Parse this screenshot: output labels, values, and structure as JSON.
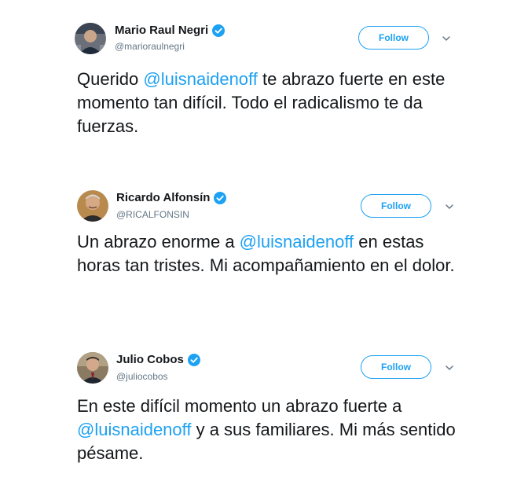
{
  "accent_color": "#1da1f2",
  "verified_badge_color": "#1da1f2",
  "tweets": [
    {
      "display_name": "Mario Raul Negri",
      "handle": "@marioraulnegri",
      "verified": true,
      "follow_label": "Follow",
      "text_before": "Querido ",
      "mention": "@luisnaidenoff",
      "text_after": " te abrazo fuerte en este momento tan difícil. Todo el radicalismo te da fuerzas."
    },
    {
      "display_name": "Ricardo Alfonsín",
      "handle": "@RICALFONSIN",
      "verified": true,
      "follow_label": "Follow",
      "text_before": "Un abrazo enorme a ",
      "mention": "@luisnaidenoff",
      "text_after": " en estas horas tan tristes. Mi acompañamiento en el dolor."
    },
    {
      "display_name": "Julio Cobos",
      "handle": "@juliocobos",
      "verified": true,
      "follow_label": "Follow",
      "text_before": "En este difícil momento un abrazo fuerte a ",
      "mention": "@luisnaidenoff",
      "text_after": " y a sus familiares. Mi más sentido pésame."
    }
  ]
}
